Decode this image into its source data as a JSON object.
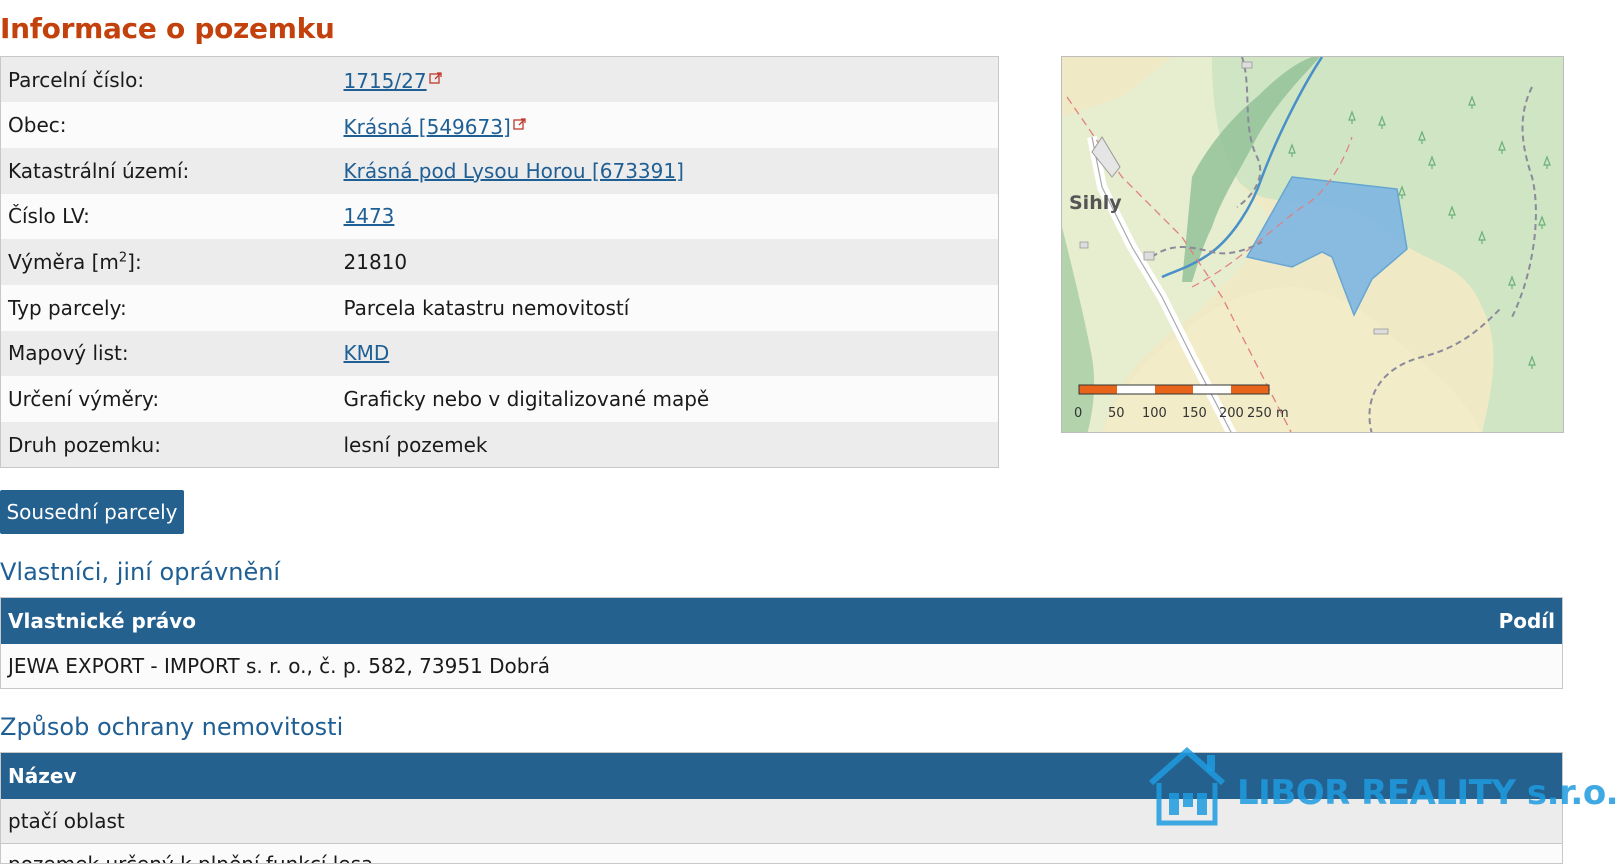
{
  "page_title": "Informace o pozemku",
  "parcel_info": {
    "rows": [
      {
        "label": "Parcelní číslo:",
        "value": "1715/27",
        "link": true,
        "external": true
      },
      {
        "label": "Obec:",
        "value": "Krásná [549673]",
        "link": true,
        "external": true
      },
      {
        "label": "Katastrální území:",
        "value": "Krásná pod Lysou Horou [673391]",
        "link": true,
        "external": false
      },
      {
        "label": "Číslo LV:",
        "value": "1473",
        "link": true,
        "external": false
      },
      {
        "label_prefix": "Výměra [m",
        "label_sup": "2",
        "label_suffix": "]:",
        "value": "21810",
        "link": false
      },
      {
        "label": "Typ parcely:",
        "value": "Parcela katastru nemovitostí",
        "link": false
      },
      {
        "label": "Mapový list:",
        "value": "KMD",
        "link": true,
        "external": false
      },
      {
        "label": "Určení výměry:",
        "value": "Graficky nebo v digitalizované mapě",
        "link": false
      },
      {
        "label": "Druh pozemku:",
        "value": "lesní pozemek",
        "link": false
      }
    ]
  },
  "map": {
    "place_label": "Sihly",
    "scale_labels": [
      "0",
      "50",
      "100",
      "150",
      "200",
      "250 m"
    ],
    "colors": {
      "parcel_fill": "#7fb6e3",
      "forest": "#c9e2c0",
      "scale_orange": "#e8641b"
    }
  },
  "neighbors_button": "Sousední parcely",
  "owners": {
    "title": "Vlastníci, jiní oprávnění",
    "col_owner": "Vlastnické právo",
    "col_share": "Podíl",
    "rows": [
      {
        "owner": "JEWA EXPORT - IMPORT s. r. o., č. p. 582, 73951 Dobrá",
        "share": ""
      }
    ]
  },
  "protection": {
    "title": "Způsob ochrany nemovitosti",
    "col_name": "Název",
    "rows": [
      "ptačí oblast"
    ],
    "partial_row": "pozemek určený k plnění funkcí lesa"
  },
  "watermark": {
    "text": "LIBOR REALITY s.r.o."
  },
  "theme": {
    "accent": "#25618f",
    "title_orange": "#c2410c",
    "link": "#1f5f94"
  }
}
